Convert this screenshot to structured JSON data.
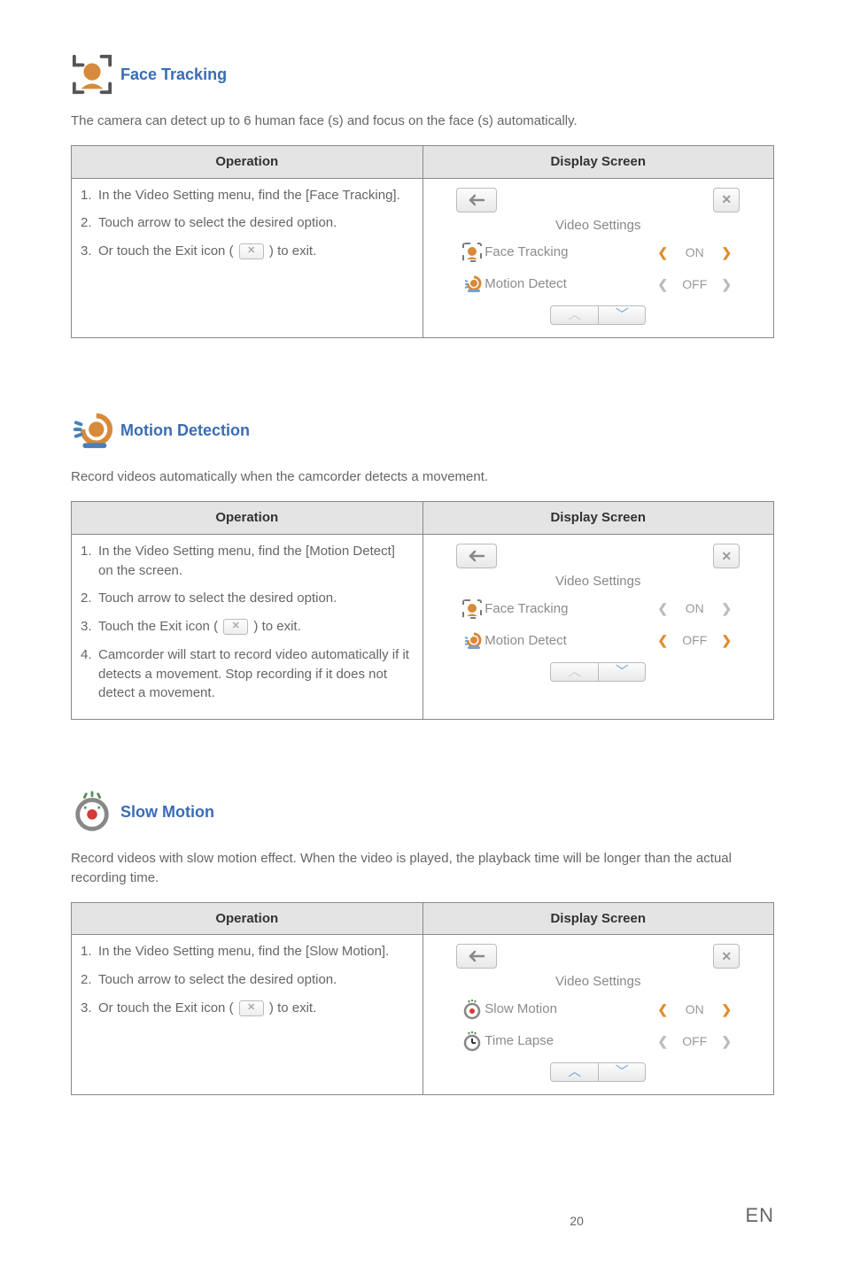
{
  "sections": [
    {
      "title": "Face Tracking",
      "intro": "The camera can detect up to 6 human face (s) and focus on the face (s) automatically.",
      "table": {
        "op_header": "Operation",
        "screen_header": "Display Screen",
        "steps": [
          {
            "num": "1.",
            "text_a": "In the Video Setting menu, find the [Face Tracking]."
          },
          {
            "num": "2.",
            "text_a": "Touch arrow to select the desired option."
          },
          {
            "num": "3.",
            "text_a": "Or touch the Exit icon (",
            "text_b": ") to exit.",
            "has_exit_icon": true
          }
        ],
        "screen": {
          "title": "Video Settings",
          "rows": [
            {
              "label": "Face Tracking",
              "value": "ON",
              "active": true,
              "icon": "face"
            },
            {
              "label": "Motion Detect",
              "value": "OFF",
              "active": false,
              "icon": "motion"
            }
          ],
          "nav_up_active": false,
          "nav_down_active": true
        }
      }
    },
    {
      "title": "Motion Detection",
      "intro": "Record videos automatically when the camcorder detects a movement.",
      "table": {
        "op_header": "Operation",
        "screen_header": "Display Screen",
        "steps": [
          {
            "num": "1.",
            "text_a": "In the Video Setting menu, find the [Motion Detect] on the screen."
          },
          {
            "num": "2.",
            "text_a": "Touch arrow to select the desired option."
          },
          {
            "num": "3.",
            "text_a": "Touch the Exit icon (",
            "text_b": ") to exit.",
            "has_exit_icon": true
          },
          {
            "num": "4.",
            "text_a": "Camcorder will start to record video automatically if it detects a movement. Stop recording if it does not detect a movement."
          }
        ],
        "screen": {
          "title": "Video Settings",
          "rows": [
            {
              "label": "Face Tracking",
              "value": "ON",
              "active": false,
              "icon": "face"
            },
            {
              "label": "Motion Detect",
              "value": "OFF",
              "active": true,
              "icon": "motion"
            }
          ],
          "nav_up_active": false,
          "nav_down_active": true
        }
      }
    },
    {
      "title": "Slow Motion",
      "intro": "Record videos with slow motion effect. When the video is played, the playback time will be longer than the actual recording time.",
      "table": {
        "op_header": "Operation",
        "screen_header": "Display Screen",
        "steps": [
          {
            "num": "1.",
            "text_a": "In the Video Setting menu, find the [Slow Motion]."
          },
          {
            "num": "2.",
            "text_a": "Touch arrow to select the desired option."
          },
          {
            "num": "3.",
            "text_a": "Or touch the Exit icon (",
            "text_b": ") to exit.",
            "has_exit_icon": true
          }
        ],
        "screen": {
          "title": "Video Settings",
          "rows": [
            {
              "label": "Slow Motion",
              "value": "ON",
              "active": true,
              "icon": "slow"
            },
            {
              "label": "Time Lapse",
              "value": "OFF",
              "active": false,
              "icon": "timelapse"
            }
          ],
          "nav_up_active": true,
          "nav_down_active": true
        }
      }
    }
  ],
  "footer": {
    "page": "20",
    "lang": "EN"
  }
}
